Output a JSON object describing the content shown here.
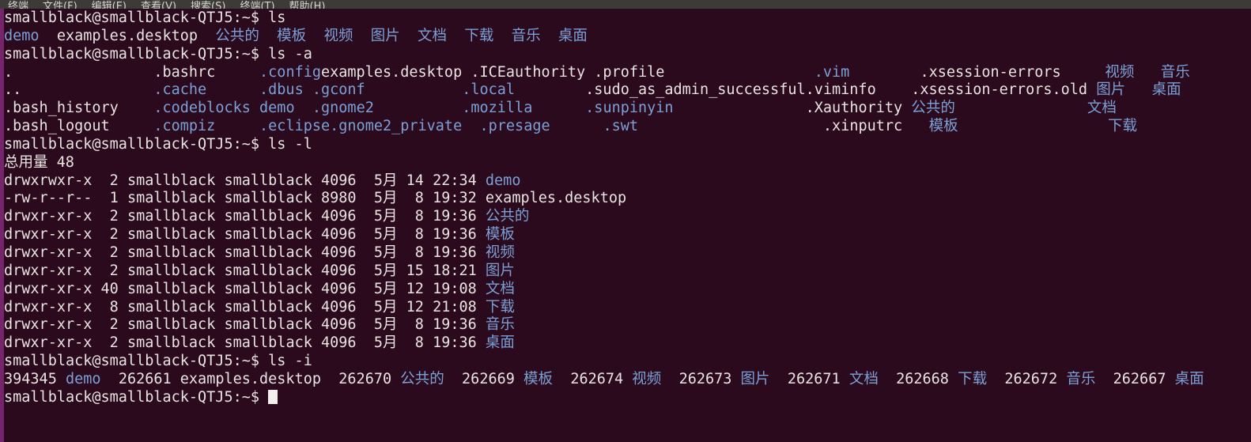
{
  "window": {
    "background_color": "#2C0A1E",
    "accent_color": "#76246B",
    "dir_color": "#7BA0D6",
    "text_color": "#E8E4E0",
    "menubar_background": "#3C3B37"
  },
  "menubar": {
    "items": [
      {
        "label": "终端"
      },
      {
        "label": "文件(F)"
      },
      {
        "label": "编辑(E)"
      },
      {
        "label": "查看(V)"
      },
      {
        "label": "搜索(S)"
      },
      {
        "label": "终端(T)"
      },
      {
        "label": "帮助(H)"
      }
    ]
  },
  "terminal": {
    "prompt": "smallblack@smallblack-QTJ5:~$ ",
    "commands": {
      "ls": "ls",
      "ls_a": "ls -a",
      "ls_l": "ls -l",
      "ls_i": "ls -i"
    },
    "ls_output": {
      "line": "demo  examples.desktop  公共的  模板  视频  图片  文档  下载  音乐  桌面",
      "entries": [
        {
          "name": "demo",
          "type": "dir"
        },
        {
          "name": "examples.desktop",
          "type": "file"
        },
        {
          "name": "公共的",
          "type": "dir"
        },
        {
          "name": "模板",
          "type": "dir"
        },
        {
          "name": "视频",
          "type": "dir"
        },
        {
          "name": "图片",
          "type": "dir"
        },
        {
          "name": "文档",
          "type": "dir"
        },
        {
          "name": "下载",
          "type": "dir"
        },
        {
          "name": "音乐",
          "type": "dir"
        },
        {
          "name": "桌面",
          "type": "dir"
        }
      ]
    },
    "ls_a_output": {
      "rows": [
        [
          {
            "name": ".",
            "type": "file"
          },
          {
            "name": ".bashrc",
            "type": "file"
          },
          {
            "name": ".config",
            "type": "dir"
          },
          {
            "name": "examples.desktop",
            "type": "file"
          },
          {
            "name": ".ICEauthority",
            "type": "file"
          },
          {
            "name": ".profile",
            "type": "file"
          },
          {
            "name": ".vim",
            "type": "dir"
          },
          {
            "name": ".xsession-errors",
            "type": "file"
          },
          {
            "name": "视频",
            "type": "dir"
          },
          {
            "name": "音乐",
            "type": "dir"
          }
        ],
        [
          {
            "name": "..",
            "type": "file"
          },
          {
            "name": ".cache",
            "type": "dir"
          },
          {
            "name": ".dbus",
            "type": "dir"
          },
          {
            "name": ".gconf",
            "type": "dir"
          },
          {
            "name": ".local",
            "type": "dir"
          },
          {
            "name": ".sudo_as_admin_successful",
            "type": "file"
          },
          {
            "name": ".viminfo",
            "type": "file"
          },
          {
            "name": ".xsession-errors.old",
            "type": "file"
          },
          {
            "name": "图片",
            "type": "dir"
          },
          {
            "name": "桌面",
            "type": "dir"
          }
        ],
        [
          {
            "name": ".bash_history",
            "type": "file"
          },
          {
            "name": ".codeblocks",
            "type": "dir"
          },
          {
            "name": "demo",
            "type": "dir"
          },
          {
            "name": ".gnome2",
            "type": "dir"
          },
          {
            "name": ".mozilla",
            "type": "dir"
          },
          {
            "name": ".sunpinyin",
            "type": "dir"
          },
          {
            "name": ".Xauthority",
            "type": "file"
          },
          {
            "name": "公共的",
            "type": "dir"
          },
          {
            "name": "文档",
            "type": "dir"
          }
        ],
        [
          {
            "name": ".bash_logout",
            "type": "file"
          },
          {
            "name": ".compiz",
            "type": "dir"
          },
          {
            "name": ".eclipse",
            "type": "dir"
          },
          {
            "name": ".gnome2_private",
            "type": "dir"
          },
          {
            "name": ".presage",
            "type": "dir"
          },
          {
            "name": ".swt",
            "type": "dir"
          },
          {
            "name": ".xinputrc",
            "type": "file"
          },
          {
            "name": "模板",
            "type": "dir"
          },
          {
            "name": "下载",
            "type": "dir"
          }
        ]
      ]
    },
    "ls_l_output": {
      "total_label": "总用量 48",
      "rows": [
        {
          "perms": "drwxrwxr-x",
          "links": "2",
          "owner": "smallblack",
          "group": "smallblack",
          "size": "4096",
          "month": "5月",
          "day": "14",
          "time": "22:34",
          "name": "demo",
          "type": "dir"
        },
        {
          "perms": "-rw-r--r--",
          "links": "1",
          "owner": "smallblack",
          "group": "smallblack",
          "size": "8980",
          "month": "5月",
          "day": "8",
          "time": "19:32",
          "name": "examples.desktop",
          "type": "file"
        },
        {
          "perms": "drwxr-xr-x",
          "links": "2",
          "owner": "smallblack",
          "group": "smallblack",
          "size": "4096",
          "month": "5月",
          "day": "8",
          "time": "19:36",
          "name": "公共的",
          "type": "dir"
        },
        {
          "perms": "drwxr-xr-x",
          "links": "2",
          "owner": "smallblack",
          "group": "smallblack",
          "size": "4096",
          "month": "5月",
          "day": "8",
          "time": "19:36",
          "name": "模板",
          "type": "dir"
        },
        {
          "perms": "drwxr-xr-x",
          "links": "2",
          "owner": "smallblack",
          "group": "smallblack",
          "size": "4096",
          "month": "5月",
          "day": "8",
          "time": "19:36",
          "name": "视频",
          "type": "dir"
        },
        {
          "perms": "drwxr-xr-x",
          "links": "2",
          "owner": "smallblack",
          "group": "smallblack",
          "size": "4096",
          "month": "5月",
          "day": "15",
          "time": "18:21",
          "name": "图片",
          "type": "dir"
        },
        {
          "perms": "drwxr-xr-x",
          "links": "40",
          "owner": "smallblack",
          "group": "smallblack",
          "size": "4096",
          "month": "5月",
          "day": "12",
          "time": "19:08",
          "name": "文档",
          "type": "dir"
        },
        {
          "perms": "drwxr-xr-x",
          "links": "8",
          "owner": "smallblack",
          "group": "smallblack",
          "size": "4096",
          "month": "5月",
          "day": "12",
          "time": "21:08",
          "name": "下载",
          "type": "dir"
        },
        {
          "perms": "drwxr-xr-x",
          "links": "2",
          "owner": "smallblack",
          "group": "smallblack",
          "size": "4096",
          "month": "5月",
          "day": "8",
          "time": "19:36",
          "name": "音乐",
          "type": "dir"
        },
        {
          "perms": "drwxr-xr-x",
          "links": "2",
          "owner": "smallblack",
          "group": "smallblack",
          "size": "4096",
          "month": "5月",
          "day": "8",
          "time": "19:36",
          "name": "桌面",
          "type": "dir"
        }
      ]
    },
    "ls_i_output": {
      "entries": [
        {
          "inode": "394345",
          "name": "demo",
          "type": "dir"
        },
        {
          "inode": "262661",
          "name": "examples.desktop",
          "type": "file"
        },
        {
          "inode": "262670",
          "name": "公共的",
          "type": "dir"
        },
        {
          "inode": "262669",
          "name": "模板",
          "type": "dir"
        },
        {
          "inode": "262674",
          "name": "视频",
          "type": "dir"
        },
        {
          "inode": "262673",
          "name": "图片",
          "type": "dir"
        },
        {
          "inode": "262671",
          "name": "文档",
          "type": "dir"
        },
        {
          "inode": "262668",
          "name": "下载",
          "type": "dir"
        },
        {
          "inode": "262672",
          "name": "音乐",
          "type": "dir"
        },
        {
          "inode": "262667",
          "name": "桌面",
          "type": "dir"
        }
      ]
    },
    "cursor": {
      "shape": "block",
      "visible": true
    }
  }
}
